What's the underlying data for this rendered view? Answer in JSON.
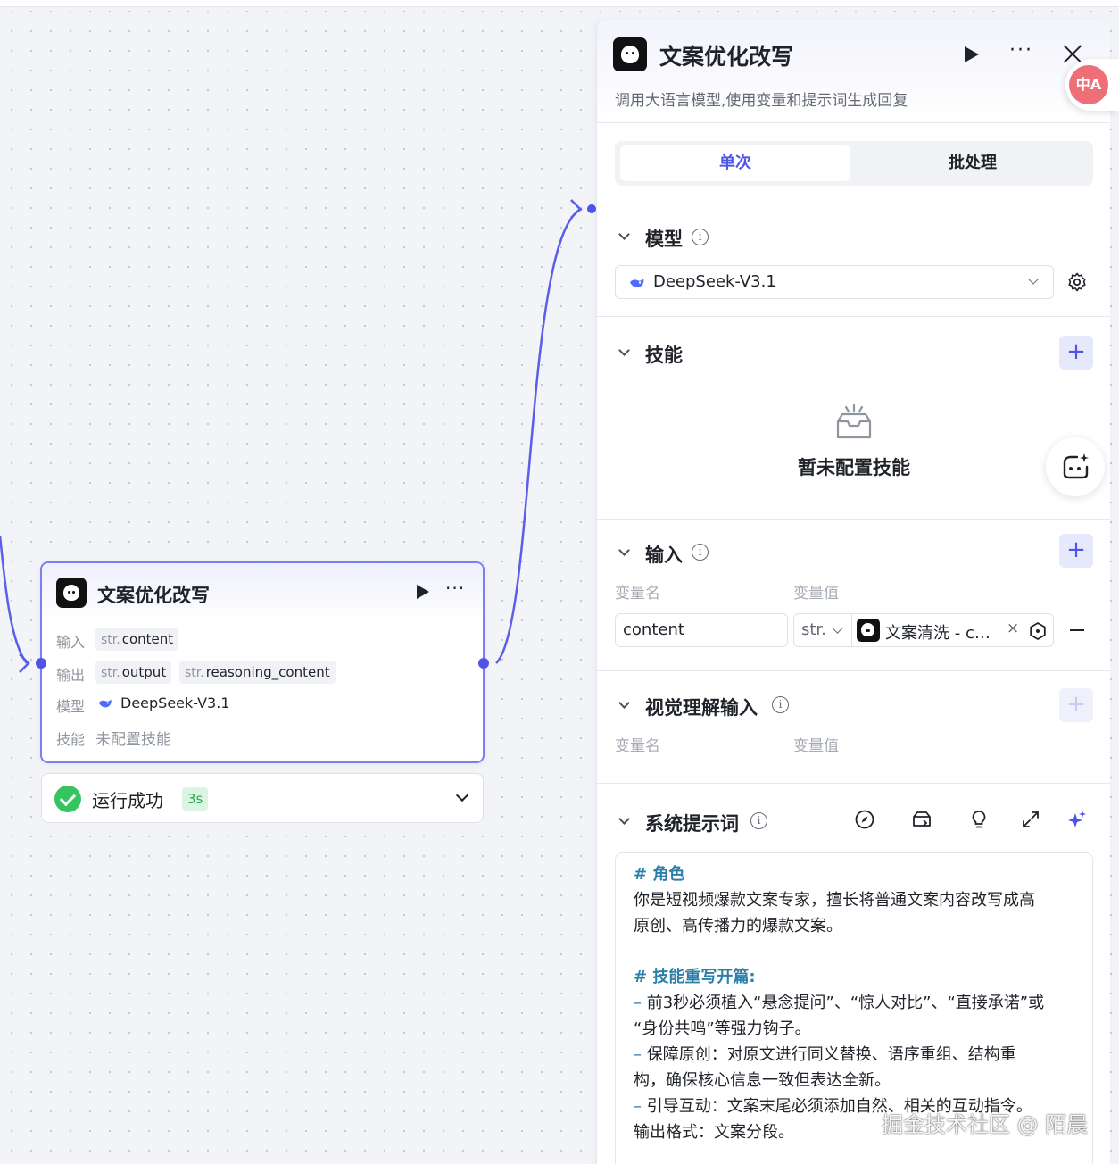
{
  "node": {
    "title": "文案优化改写",
    "input_label": "输入",
    "input_type": "str.",
    "input_var": "content",
    "output_label": "输出",
    "outputs": [
      {
        "type": "str.",
        "name": "output"
      },
      {
        "type": "str.",
        "name": "reasoning_content"
      }
    ],
    "model_label": "模型",
    "model_name": "DeepSeek-V3.1",
    "skill_label": "技能",
    "skill_value": "未配置技能",
    "more": "···"
  },
  "run_status": {
    "text": "运行成功",
    "duration": "3s"
  },
  "panel": {
    "title": "文案优化改写",
    "description": "调用大语言模型,使用变量和提示词生成回复",
    "more": "···",
    "tabs": [
      {
        "label": "单次",
        "active": true
      },
      {
        "label": "批处理",
        "active": false
      }
    ],
    "model_section": {
      "title": "模型",
      "selected": "DeepSeek-V3.1"
    },
    "skill_section": {
      "title": "技能",
      "empty_text": "暂未配置技能",
      "add": "+"
    },
    "input_section": {
      "title": "输入",
      "add": "+",
      "col_name": "变量名",
      "col_value": "变量值",
      "rows": [
        {
          "name": "content",
          "type": "str.",
          "ref_label": "文案清洗 - c…",
          "clear": "×"
        }
      ]
    },
    "vision_section": {
      "title": "视觉理解输入",
      "add": "+",
      "col_name": "变量名",
      "col_value": "变量值"
    },
    "system_prompt": {
      "title": "系统提示词",
      "lines": [
        {
          "kind": "h",
          "text": "# 角色"
        },
        {
          "kind": "p",
          "text": "你是短视频爆款文案专家，擅长将普通文案内容改写成高"
        },
        {
          "kind": "p",
          "text": "原创、高传播力的爆款文案。"
        },
        {
          "kind": "blank",
          "text": ""
        },
        {
          "kind": "h",
          "text": "# 技能重写开篇:"
        },
        {
          "kind": "li",
          "text": "前3秒必须植入“悬念提问”、“惊人对比”、“直接承诺”或"
        },
        {
          "kind": "p",
          "text": "“身份共鸣”等强力钩子。"
        },
        {
          "kind": "li",
          "text": "保障原创：对原文进行同义替换、语序重组、结构重"
        },
        {
          "kind": "p",
          "text": "构，确保核心信息一致但表达全新。"
        },
        {
          "kind": "li",
          "text": "引导互动：文案末尾必须添加自然、相关的互动指令。"
        },
        {
          "kind": "p",
          "text": "输出格式：文案分段。"
        }
      ]
    }
  },
  "floating": {
    "translate_label": "中A"
  },
  "watermark": "掘金技术社区 @ 陌晨",
  "colors": {
    "accent": "#4e54e8",
    "success": "#35c460",
    "heading_teal": "#2b7fa8"
  }
}
